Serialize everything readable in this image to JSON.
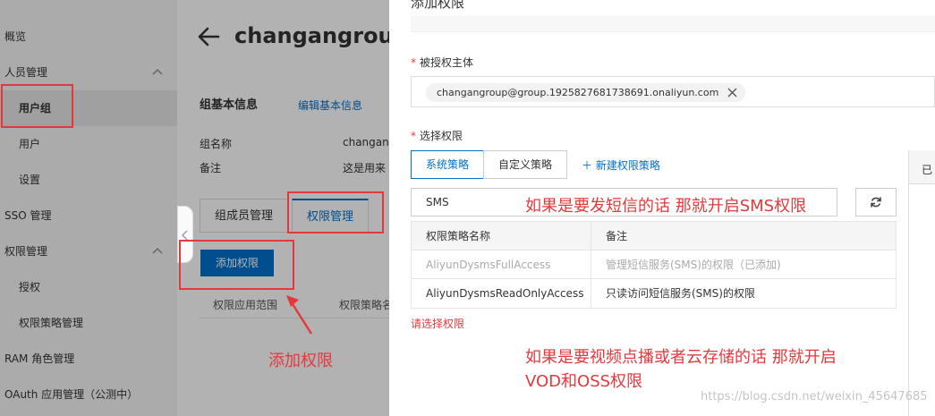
{
  "sidebar": {
    "items": [
      {
        "label": "概览",
        "type": "top"
      },
      {
        "label": "人员管理",
        "type": "top",
        "expanded": true
      },
      {
        "label": "用户组",
        "type": "sub",
        "active": true
      },
      {
        "label": "用户",
        "type": "sub"
      },
      {
        "label": "设置",
        "type": "sub"
      },
      {
        "label": "SSO 管理",
        "type": "top"
      },
      {
        "label": "权限管理",
        "type": "top",
        "expanded": true
      },
      {
        "label": "授权",
        "type": "sub"
      },
      {
        "label": "权限策略管理",
        "type": "sub"
      },
      {
        "label": "RAM 角色管理",
        "type": "top"
      },
      {
        "label": "OAuth 应用管理（公测中）",
        "type": "top"
      }
    ]
  },
  "main": {
    "title": "changangroup",
    "section_title": "组基本信息",
    "edit_link": "编辑基本信息",
    "info": [
      {
        "label": "组名称",
        "value": "changang"
      },
      {
        "label": "备注",
        "value": "这是用来"
      }
    ],
    "tabs": [
      {
        "label": "组成员管理",
        "active": false
      },
      {
        "label": "权限管理",
        "active": true
      }
    ],
    "add_button": "添加权限",
    "columns": [
      "权限应用范围",
      "权限策略名"
    ]
  },
  "drawer": {
    "title": "添加权限",
    "subject_label": "被授权主体",
    "subject_value": "changangroup@group.1925827681738691.onaliyun.com",
    "policy_label": "选择权限",
    "segments": [
      "系统策略",
      "自定义策略"
    ],
    "new_policy_link": "新建权限策略",
    "search_value": "SMS",
    "table": {
      "headers": [
        "权限策略名称",
        "备注"
      ],
      "rows": [
        {
          "name": "AliyunDysmsFullAccess",
          "note": "管理短信服务(SMS)的权限（已添加)",
          "disabled": true
        },
        {
          "name": "AliyunDysmsReadOnlyAccess",
          "note": "只读访问短信服务(SMS)的权限",
          "disabled": false
        }
      ]
    },
    "error_text": "请选择权限",
    "selected_panel_label": "已"
  },
  "annotations": {
    "sms_note": "如果是要发短信的话  那就开启SMS权限",
    "add_note": "添加权限",
    "vod_note_line1": "如果是要视频点播或者云存储的话  那就开启",
    "vod_note_line2": "VOD和OSS权限",
    "watermark": "https://blog.csdn.net/weixin_45647685"
  },
  "colors": {
    "accent": "#0070cc",
    "annotation_red": "#e4393c",
    "sidebar_bg": "#f5f5f5"
  }
}
